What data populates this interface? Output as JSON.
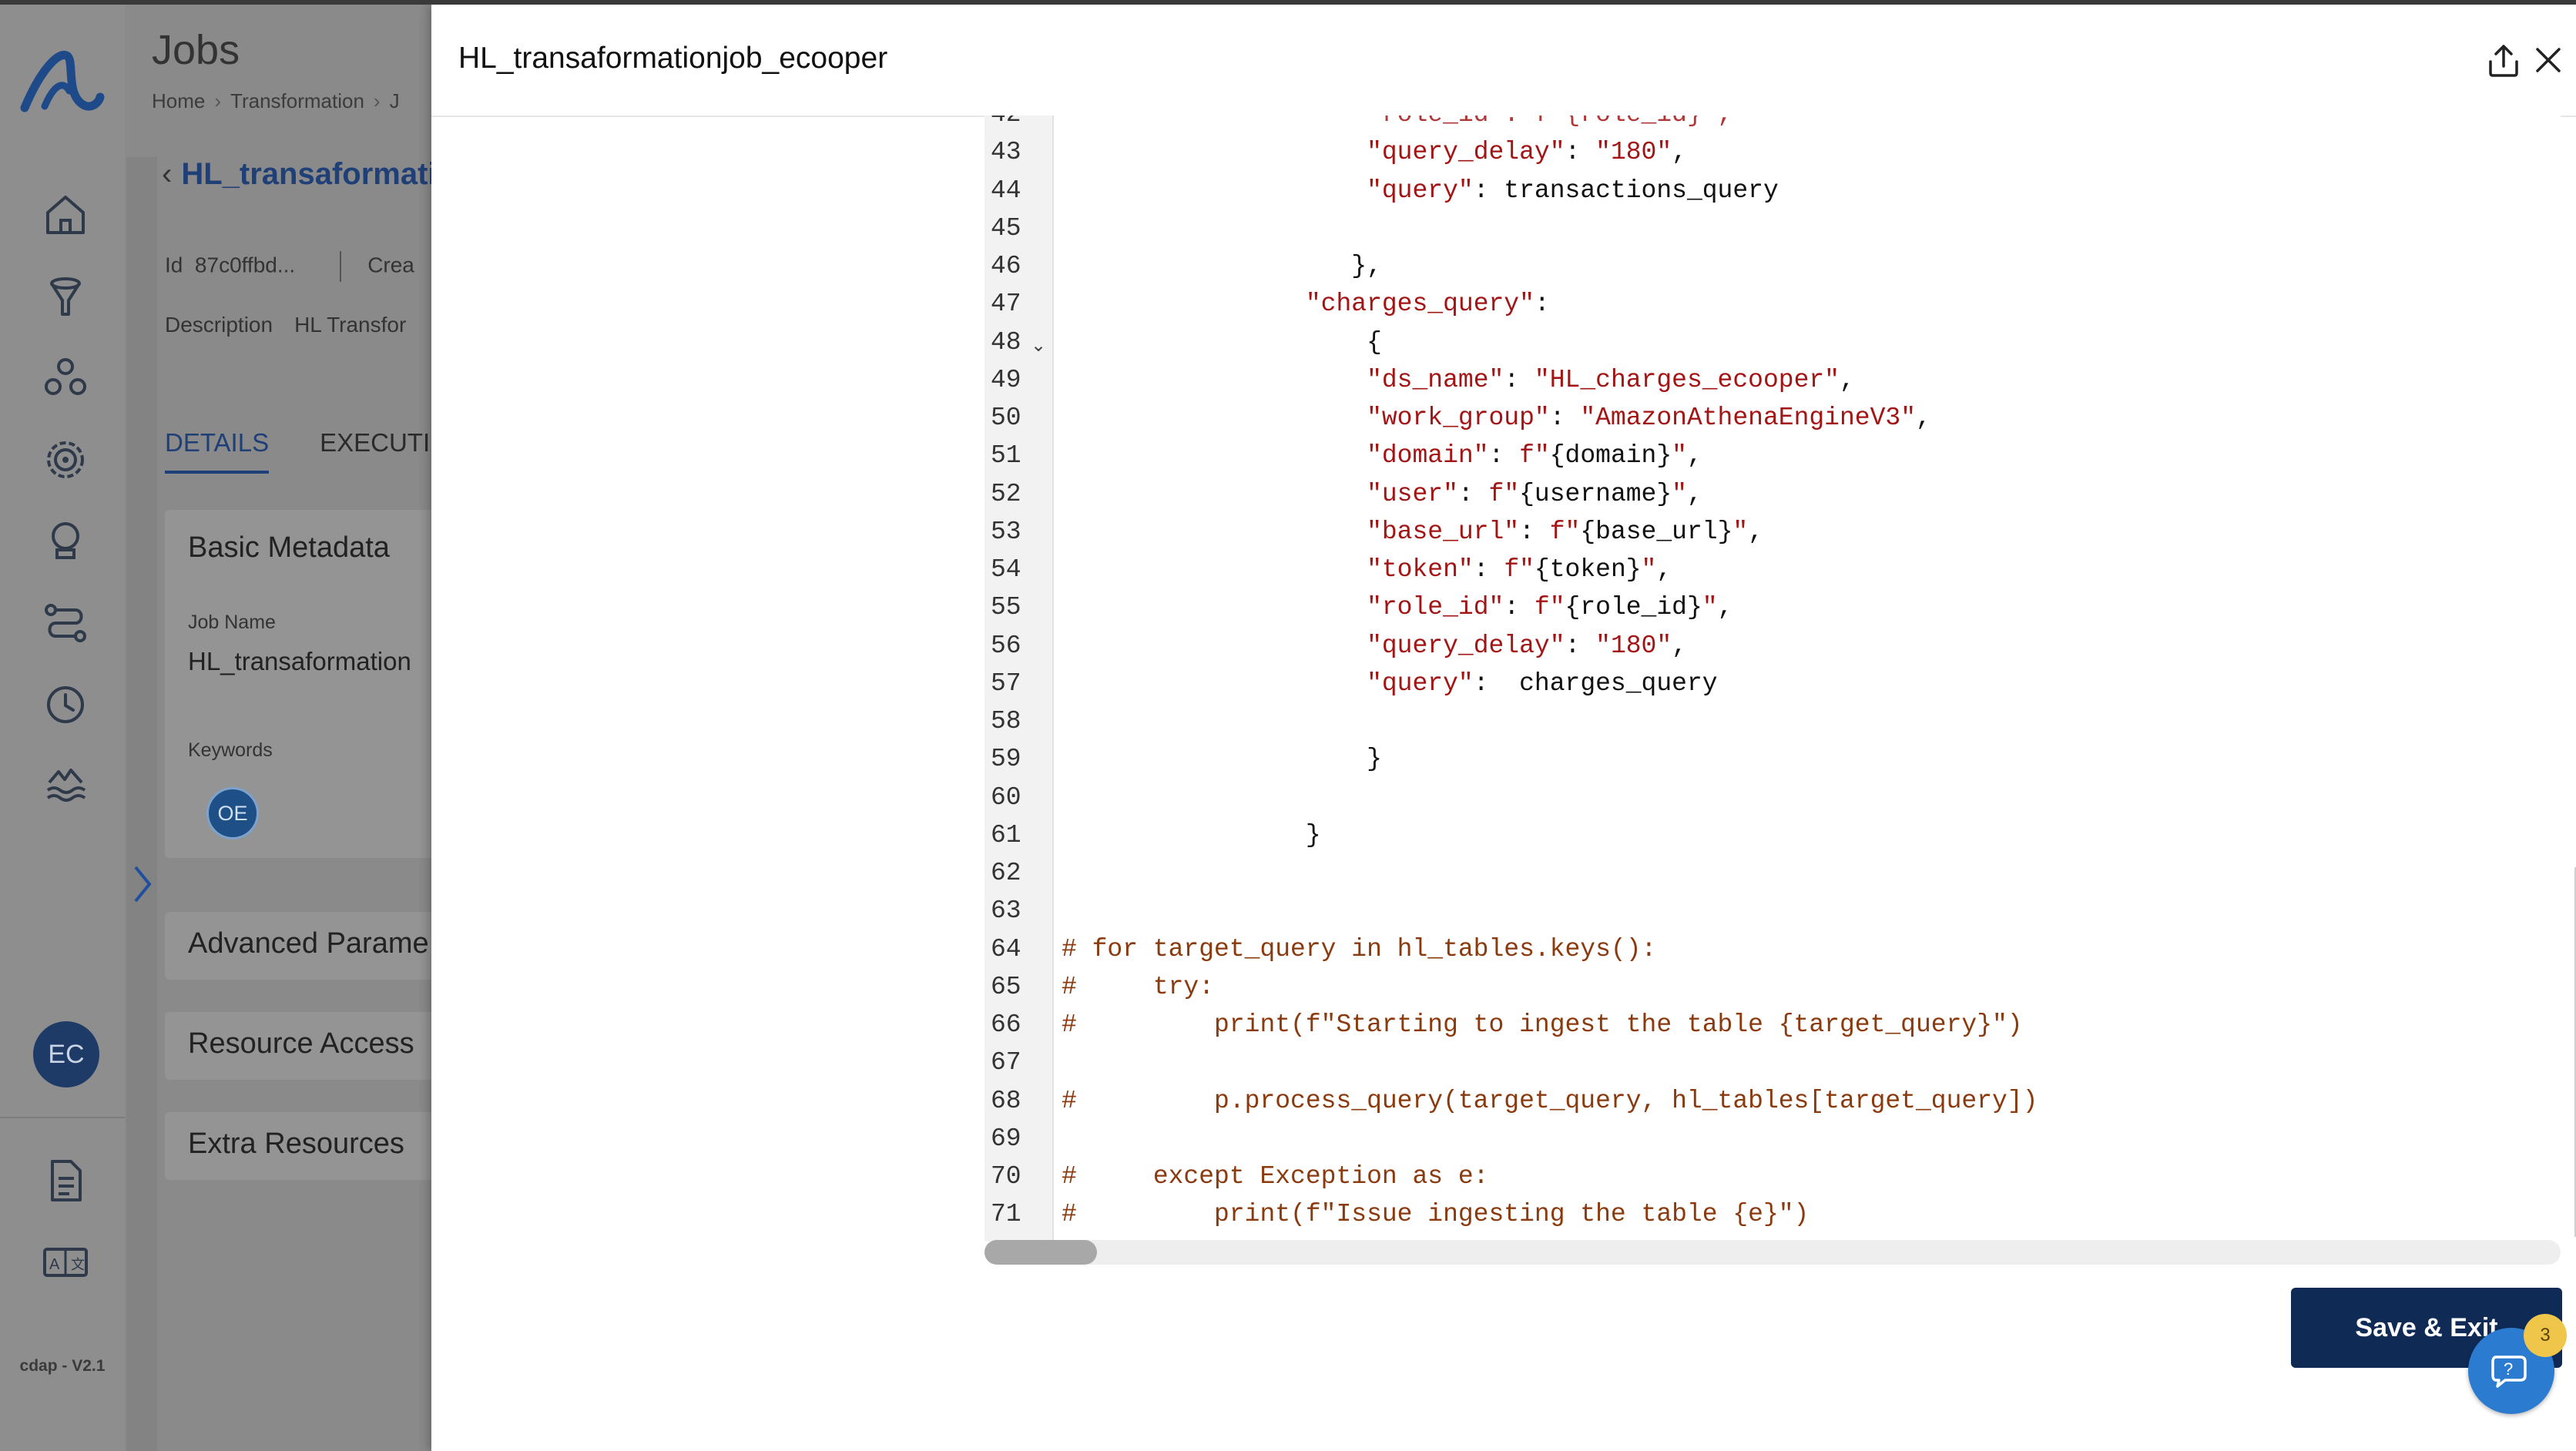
{
  "app": {
    "version": "cdap - V2.1",
    "user_initials": "EC",
    "page_title": "Jobs",
    "breadcrumb": [
      "Home",
      "Transformation",
      "J"
    ],
    "job_title": "HL_transaformatio",
    "id_label": "Id",
    "id_value": "87c0ffbd...",
    "created_label": "Crea",
    "description_label": "Description",
    "description_value": "HL Transfor",
    "tabs": [
      "DETAILS",
      "EXECUTI"
    ],
    "basic_metadata_title": "Basic Metadata",
    "job_name_label": "Job Name",
    "job_name_value": "HL_transaformation",
    "keywords_label": "Keywords",
    "keyword_chip": "OE",
    "sections": [
      "Advanced Parame",
      "Resource Access",
      "Extra Resources"
    ]
  },
  "drawer": {
    "title": "HL_transaformationjob_ecooper",
    "save_label": "Save & Exit",
    "help_badge": "3"
  },
  "code": {
    "partial_top_line": "\"role_id\": f\"{role_id}\",",
    "lines": [
      {
        "n": "43",
        "t": "                    <s>\"query_delay\"</s>: <s>\"180\"</s>,"
      },
      {
        "n": "44",
        "t": "                    <s>\"query\"</s>: transactions_query"
      },
      {
        "n": "45",
        "t": ""
      },
      {
        "n": "46",
        "t": "                   },"
      },
      {
        "n": "47",
        "t": "                <s>\"charges_query\"</s>:"
      },
      {
        "n": "48",
        "t": "                    {",
        "fold": true
      },
      {
        "n": "49",
        "t": "                    <s>\"ds_name\"</s>: <s>\"HL_charges_ecooper\"</s>,"
      },
      {
        "n": "50",
        "t": "                    <s>\"work_group\"</s>: <s>\"AmazonAthenaEngineV3\"</s>,"
      },
      {
        "n": "51",
        "t": "                    <s>\"domain\"</s>: <s>f\"</s>{domain}<s>\"</s>,"
      },
      {
        "n": "52",
        "t": "                    <s>\"user\"</s>: <s>f\"</s>{username}<s>\"</s>,"
      },
      {
        "n": "53",
        "t": "                    <s>\"base_url\"</s>: <s>f\"</s>{base_url}<s>\"</s>,"
      },
      {
        "n": "54",
        "t": "                    <s>\"token\"</s>: <s>f\"</s>{token}<s>\"</s>,"
      },
      {
        "n": "55",
        "t": "                    <s>\"role_id\"</s>: <s>f\"</s>{role_id}<s>\"</s>,"
      },
      {
        "n": "56",
        "t": "                    <s>\"query_delay\"</s>: <s>\"180\"</s>,"
      },
      {
        "n": "57",
        "t": "                    <s>\"query\"</s>:  charges_query"
      },
      {
        "n": "58",
        "t": ""
      },
      {
        "n": "59",
        "t": "                    }"
      },
      {
        "n": "60",
        "t": ""
      },
      {
        "n": "61",
        "t": "                }"
      },
      {
        "n": "62",
        "t": ""
      },
      {
        "n": "63",
        "t": ""
      },
      {
        "n": "64",
        "t": "<c># for target_query in hl_tables.keys():</c>"
      },
      {
        "n": "65",
        "t": "<c>#     try:</c>"
      },
      {
        "n": "66",
        "t": "<c>#         print(f\"Starting to ingest the table {target_query}\")</c>"
      },
      {
        "n": "67",
        "t": ""
      },
      {
        "n": "68",
        "t": "<c>#         p.process_query(target_query, hl_tables[target_query])</c>"
      },
      {
        "n": "69",
        "t": ""
      },
      {
        "n": "70",
        "t": "<c>#     except Exception as e:</c>"
      },
      {
        "n": "71",
        "t": "<c>#         print(f\"Issue ingesting the table {e}\")</c>"
      }
    ]
  }
}
